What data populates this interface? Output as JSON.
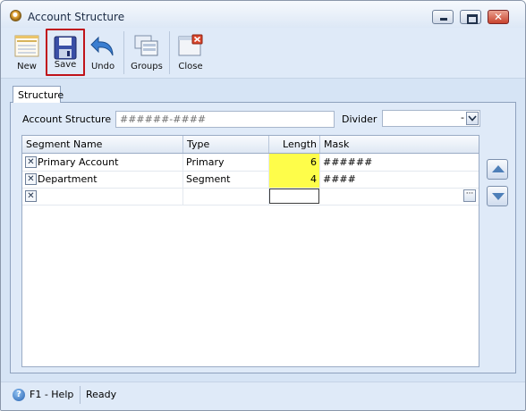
{
  "window": {
    "title": "Account Structure"
  },
  "toolbar": {
    "new_label": "New",
    "save_label": "Save",
    "undo_label": "Undo",
    "groups_label": "Groups",
    "close_label": "Close"
  },
  "tabs": [
    {
      "label": "Structure",
      "selected": true
    }
  ],
  "form": {
    "account_structure_label": "Account Structure",
    "account_structure_value": "######-####",
    "divider_label": "Divider",
    "divider_value": "-"
  },
  "grid": {
    "columns": [
      "Segment Name",
      "Type",
      "Length",
      "Mask"
    ],
    "rows": [
      {
        "segment_name": "Primary Account",
        "type": "Primary",
        "length": "6",
        "mask": "######"
      },
      {
        "segment_name": "Department",
        "type": "Segment",
        "length": "4",
        "mask": "####"
      }
    ],
    "new_row_ellipsis": "···"
  },
  "statusbar": {
    "help": "F1 - Help",
    "status": "Ready"
  },
  "colors": {
    "highlight": "#fefd4a",
    "save_outline": "#c0131a",
    "window_bg": "#d6e4f5"
  }
}
